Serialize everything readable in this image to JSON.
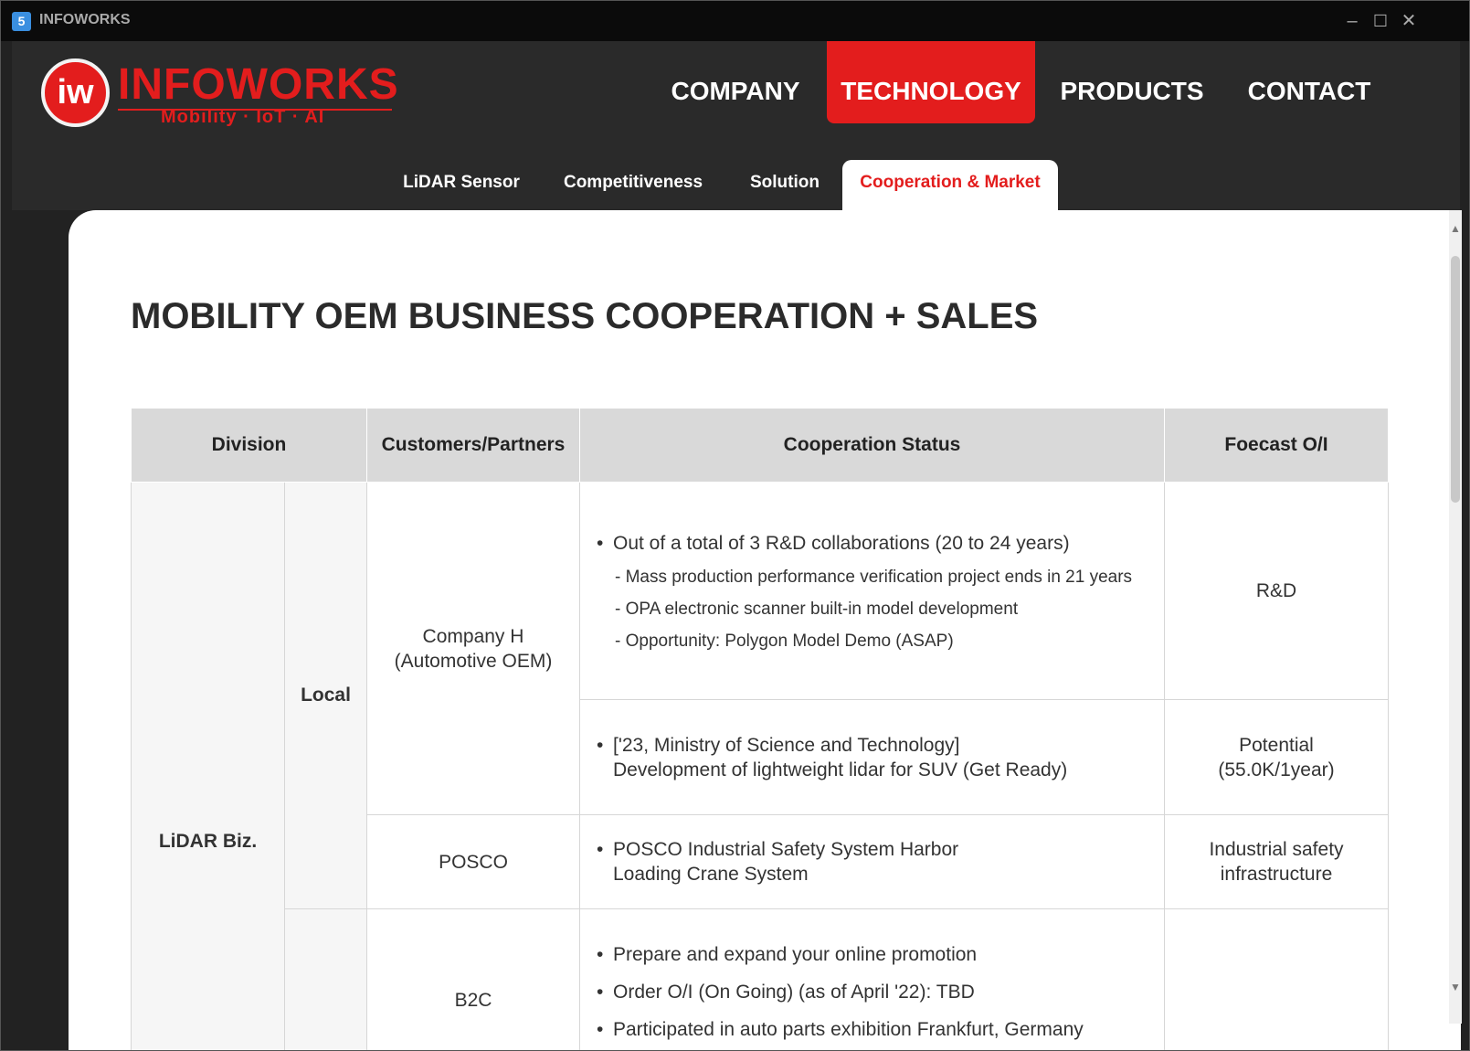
{
  "window": {
    "title": "INFOWORKS"
  },
  "logo": {
    "mark": "iw",
    "name": "INFOWORKS",
    "tagline": "Mobility · IoT · AI"
  },
  "nav": {
    "items": [
      {
        "label": "COMPANY"
      },
      {
        "label": "TECHNOLOGY"
      },
      {
        "label": "PRODUCTS"
      },
      {
        "label": "CONTACT"
      }
    ],
    "active": "TECHNOLOGY"
  },
  "subnav": {
    "items": [
      {
        "label": "LiDAR Sensor"
      },
      {
        "label": "Competitiveness"
      },
      {
        "label": "Solution"
      },
      {
        "label": "Cooperation & Market"
      }
    ],
    "active": "Cooperation & Market"
  },
  "page": {
    "title": "MOBILITY OEM BUSINESS COOPERATION + SALES"
  },
  "table": {
    "headers": [
      "Division",
      "Customers/Partners",
      "Cooperation Status",
      "Foecast O/I"
    ],
    "division": "LiDAR Biz.",
    "region": "Local",
    "rows": [
      {
        "customer_line1": "Company H",
        "customer_line2": "(Automotive OEM)",
        "status_main": "Out of a total of 3 R&D collaborations (20 to 24 years)",
        "status_sub": [
          "- Mass production performance verification project ends in 21 years",
          "- OPA electronic scanner built-in model development",
          "- Opportunity: Polygon Model Demo (ASAP)"
        ],
        "forecast_line1": "R&D",
        "forecast_line2": ""
      },
      {
        "status_line1": "['23, Ministry of Science and Technology]",
        "status_line2": "Development of lightweight lidar for SUV (Get Ready)",
        "forecast_line1": "Potential",
        "forecast_line2": "(55.0K/1year)"
      },
      {
        "customer_line1": "POSCO",
        "status_line1": "POSCO Industrial Safety System Harbor",
        "status_line2": "Loading Crane System",
        "forecast_line1": "Industrial safety",
        "forecast_line2": "infrastructure"
      },
      {
        "customer_line1": "B2C",
        "status_items": [
          "Prepare and expand your online promotion",
          "Order O/I (On Going) (as of April '22): TBD",
          "Participated in auto parts exhibition Frankfurt, Germany"
        ]
      }
    ]
  }
}
